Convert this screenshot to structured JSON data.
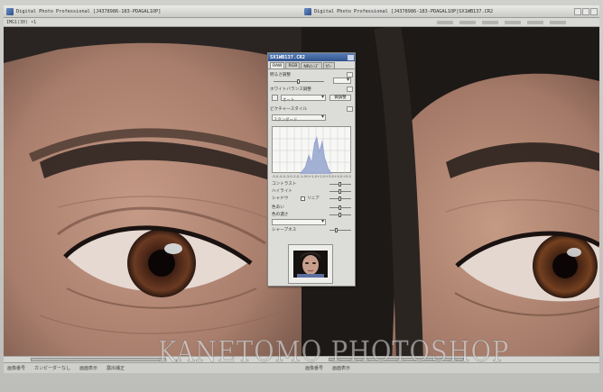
{
  "left_window": {
    "title": "Digital Photo Professional",
    "path": "[J4378986-183-PDAGAL1OP]",
    "sub_title": "IMG1(30) •1",
    "status": [
      "画像番号",
      "カンピーダーなし",
      "画面表示",
      "露出補正"
    ]
  },
  "right_window": {
    "title": "Digital Photo Professional",
    "path": "[J4378986-183-PDAGAL1OP]SX1WB137.CR2",
    "status": [
      "画像番号",
      "画面表示"
    ]
  },
  "palette": {
    "title": "SX1WB137.CR2",
    "tabs": [
      "RAW",
      "RGB",
      "NR/ﾚﾝｽﾞ",
      "ｶﾗｰ"
    ],
    "section_brightness": "明るさ調整",
    "section_wb": "ホワイトバランス調整",
    "wb_select": "オート",
    "wb_button": "微調整",
    "section_picture_style": "ピクチャースタイル",
    "ps_select": "スタンダード",
    "hist_ticks": [
      "-5.0",
      "-4.0",
      "-3.0",
      "-2.0",
      "-1.0",
      "0",
      "+1.0",
      "+2.0",
      "+3.0",
      "+4.0",
      "+5.0"
    ],
    "rows": [
      "コントラスト",
      "ハイライト",
      "シャドウ",
      "色あい",
      "色の濃さ",
      "シャープネス"
    ],
    "linear_label": "リニア",
    "sharp_select": "シャープネス"
  },
  "watermark": "KANETOMO PHOTOSHOP",
  "colors": {
    "palette_title": "#2f538d",
    "window_bg": "#c9c9c6"
  }
}
